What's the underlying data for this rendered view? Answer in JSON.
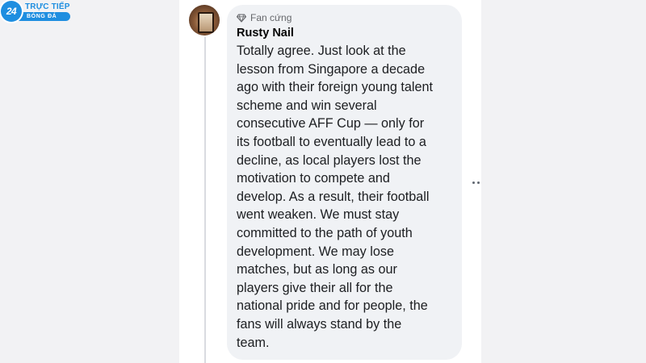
{
  "logo": {
    "mark": "24",
    "line1": "TRỰC TIẾP",
    "line2": "BÓNG ĐÁ"
  },
  "comment": {
    "badge_icon": "diamond-icon",
    "badge_label": "Fan cứng",
    "author": "Rusty Nail",
    "lines": [
      "Totally agree. Just look at the",
      "lesson from Singapore a decade",
      "ago with their foreign young talent",
      "scheme and win several",
      "consecutive AFF Cup — only for",
      "its football to eventually lead to a",
      "decline, as local players lost the",
      "motivation to compete and",
      "develop. As a result, their football",
      "went weaken. We must stay",
      "committed to the path of youth",
      "development. We may lose",
      "matches, but as long as our",
      "players give their all for the",
      "national pride and for people, the",
      "fans will always stand by the",
      "team."
    ]
  },
  "actions": {
    "more_icon": "more-horizontal-icon"
  },
  "colors": {
    "bubble_bg": "#f0f2f5",
    "text": "#1c1e21",
    "secondary_text": "#65676b",
    "brand_blue": "#1e8ee0"
  }
}
